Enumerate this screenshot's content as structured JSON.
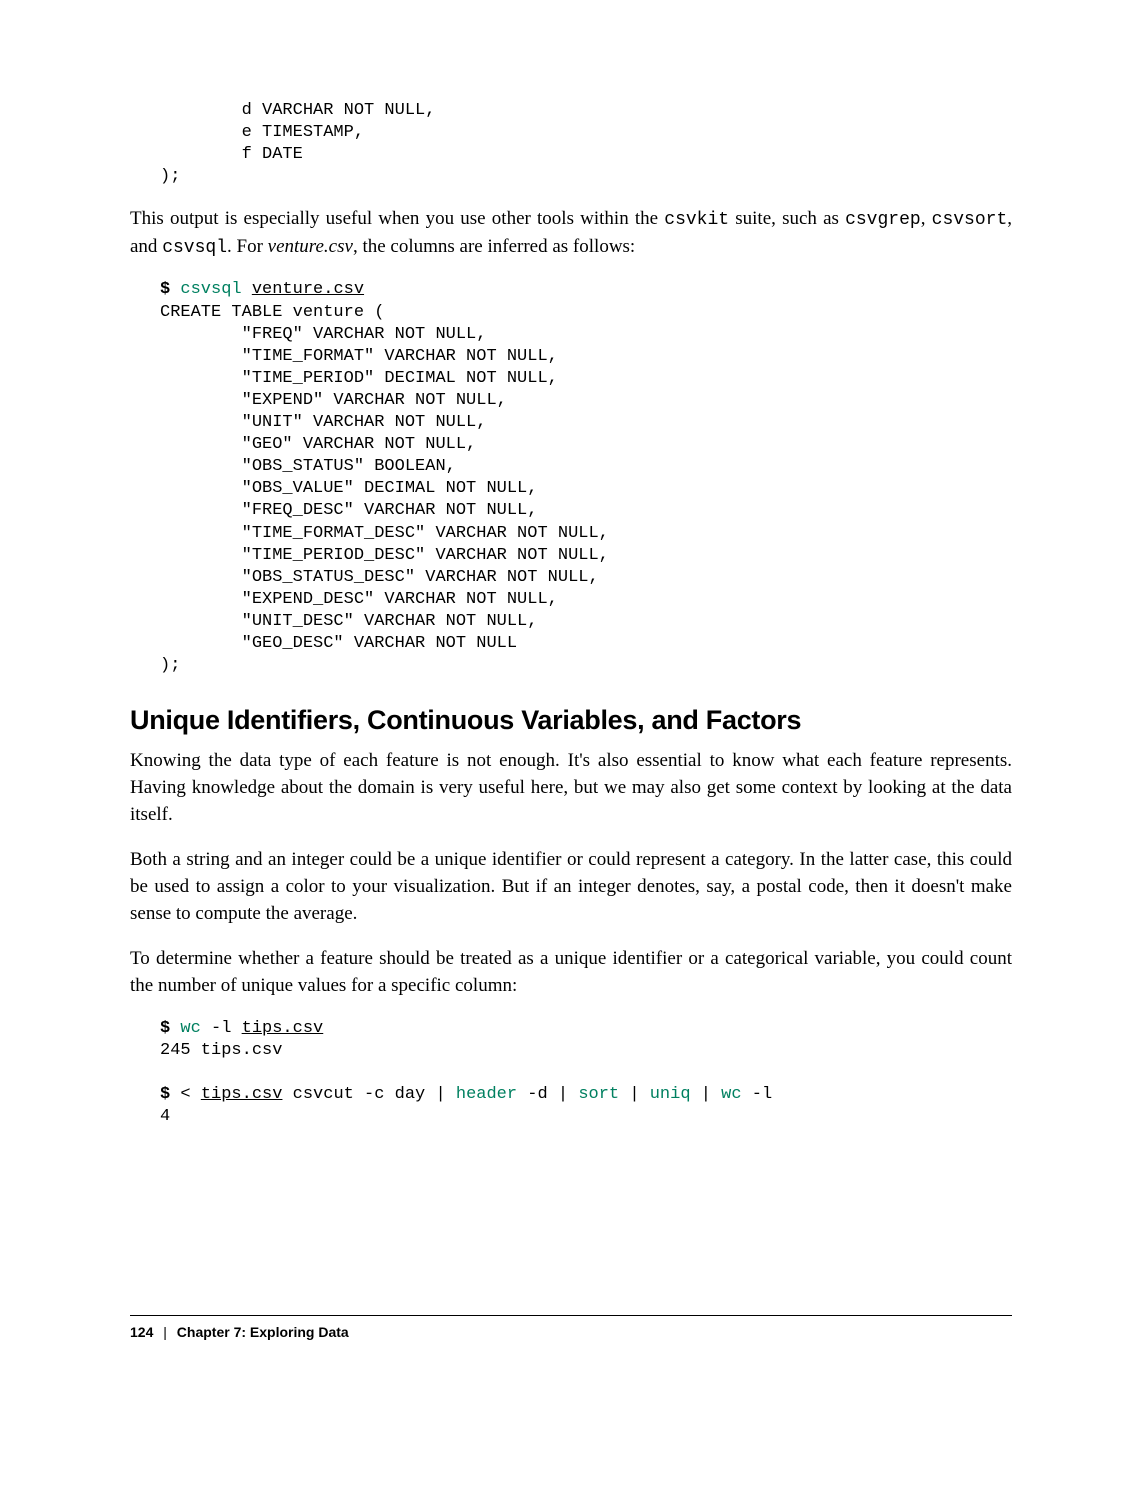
{
  "code1": "        d VARCHAR NOT NULL,\n        e TIMESTAMP,\n        f DATE\n);",
  "para1_a": "This output is especially useful when you use other tools within the ",
  "para1_b": "csvkit",
  "para1_c": " suite, such as ",
  "para1_d": "csvgrep",
  "para1_e": ", ",
  "para1_f": "csvsort",
  "para1_g": ", and ",
  "para1_h": "csvsql",
  "para1_i": ". For ",
  "para1_j": "venture.csv",
  "para1_k": ", the columns are inferred as follows:",
  "code2_prompt": "$ ",
  "code2_cmd": "csvsql",
  "code2_sp": " ",
  "code2_arg": "venture.csv",
  "code2_rest": "CREATE TABLE venture (\n        \"FREQ\" VARCHAR NOT NULL,\n        \"TIME_FORMAT\" VARCHAR NOT NULL,\n        \"TIME_PERIOD\" DECIMAL NOT NULL,\n        \"EXPEND\" VARCHAR NOT NULL,\n        \"UNIT\" VARCHAR NOT NULL,\n        \"GEO\" VARCHAR NOT NULL,\n        \"OBS_STATUS\" BOOLEAN,\n        \"OBS_VALUE\" DECIMAL NOT NULL,\n        \"FREQ_DESC\" VARCHAR NOT NULL,\n        \"TIME_FORMAT_DESC\" VARCHAR NOT NULL,\n        \"TIME_PERIOD_DESC\" VARCHAR NOT NULL,\n        \"OBS_STATUS_DESC\" VARCHAR NOT NULL,\n        \"EXPEND_DESC\" VARCHAR NOT NULL,\n        \"UNIT_DESC\" VARCHAR NOT NULL,\n        \"GEO_DESC\" VARCHAR NOT NULL\n);",
  "heading": "Unique Identifiers, Continuous Variables, and Factors",
  "para2": "Knowing the data type of each feature is not enough. It's also essential to know what each feature represents. Having knowledge about the domain is very useful here, but we may also get some context by looking at the data itself.",
  "para3": "Both a string and an integer could be a unique identifier or could represent a category. In the latter case, this could be used to assign a color to your visualization. But if an integer denotes, say, a postal code, then it doesn't make sense to compute the average.",
  "para4": "To determine whether a feature should be treated as a unique identifier or a categorical variable, you could count the number of unique values for a specific column:",
  "code3_prompt": "$ ",
  "code3_cmd": "wc",
  "code3_flags": " -l ",
  "code3_arg": "tips.csv",
  "code3_out": "245 tips.csv",
  "code4_prompt": "$ ",
  "code4_a": "< ",
  "code4_arg": "tips.csv",
  "code4_b": " csvcut -c day | ",
  "code4_c": "header",
  "code4_d": " -d | ",
  "code4_e": "sort",
  "code4_f": " | ",
  "code4_g": "uniq",
  "code4_h": " | ",
  "code4_i": "wc",
  "code4_j": " -l",
  "code4_out": "4",
  "footer_page": "124",
  "footer_sep": "|",
  "footer_chapter": "Chapter 7: Exploring Data"
}
